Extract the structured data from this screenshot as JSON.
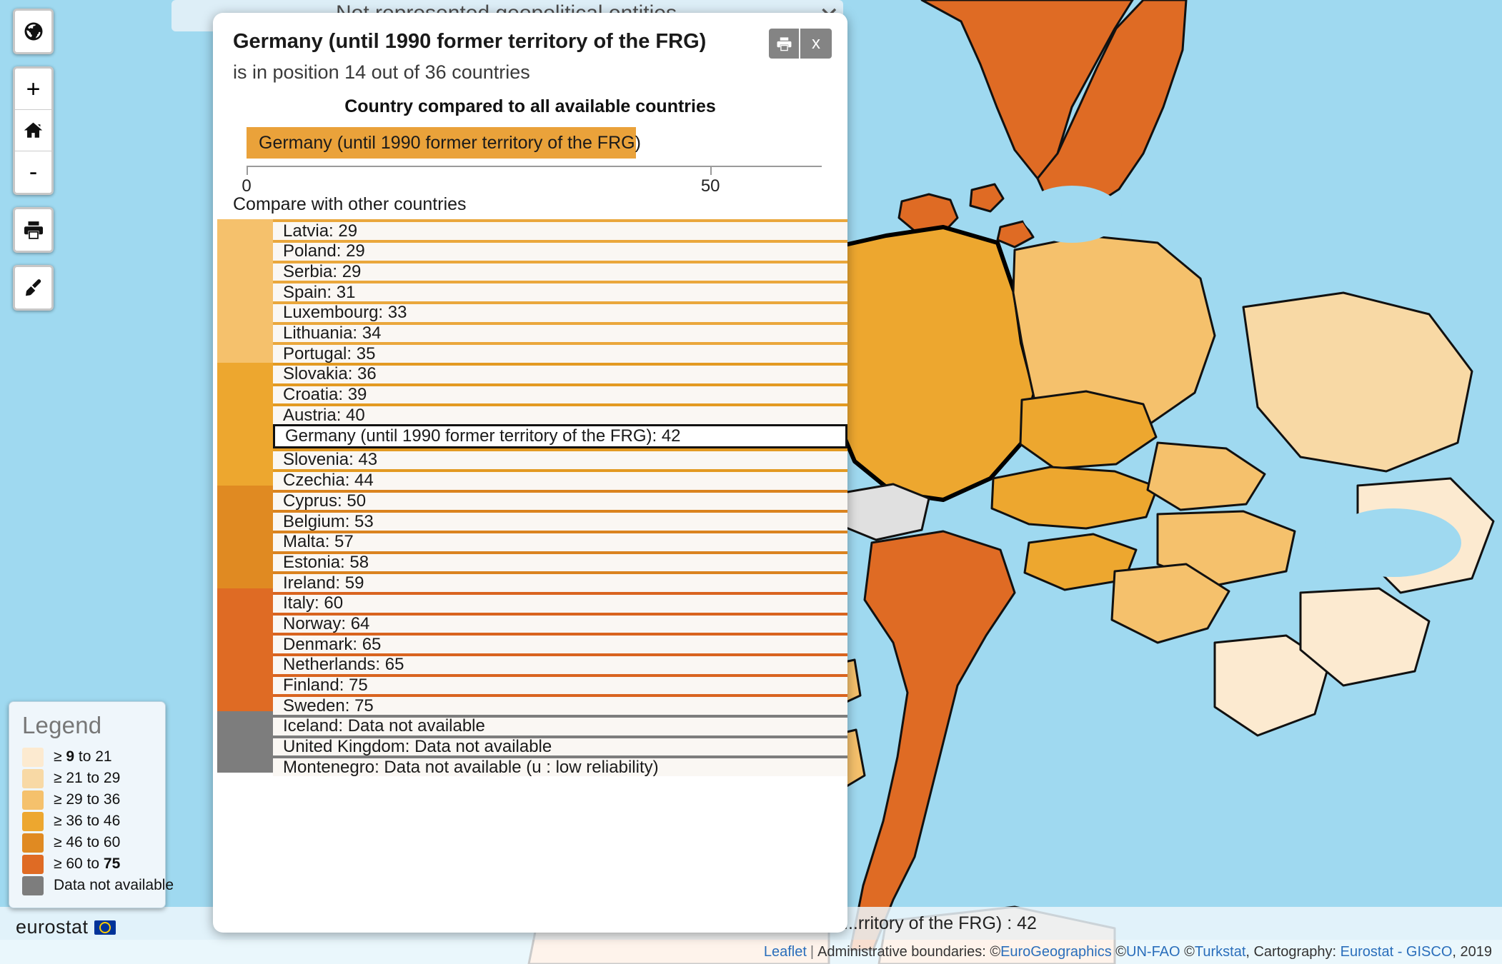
{
  "app": {
    "background_title": "Not represented geopolitical entities",
    "background_close_icon": "close-icon"
  },
  "toolbar": {
    "groups": [
      {
        "buttons": [
          {
            "name": "globe-icon",
            "label": ""
          }
        ]
      },
      {
        "buttons": [
          {
            "name": "zoom-in-icon",
            "label": "+"
          },
          {
            "name": "home-icon",
            "label": ""
          },
          {
            "name": "zoom-out-icon",
            "label": "-"
          }
        ]
      },
      {
        "buttons": [
          {
            "name": "print-icon",
            "label": ""
          }
        ]
      },
      {
        "buttons": [
          {
            "name": "brush-icon",
            "label": ""
          }
        ]
      }
    ]
  },
  "legend": {
    "title": "Legend",
    "items": [
      {
        "color": "#fcead0",
        "prefix": "≥ ",
        "bold_low": "9",
        "mid": " to ",
        "high": "21",
        "bold_high": false
      },
      {
        "color": "#f8d9a5",
        "prefix": "≥ ",
        "bold_low": "21",
        "mid": " to ",
        "high": "29",
        "bold_high": false
      },
      {
        "color": "#f5c16c",
        "prefix": "≥ ",
        "bold_low": "29",
        "mid": " to ",
        "high": "36",
        "bold_high": false
      },
      {
        "color": "#eda72f",
        "prefix": "≥ ",
        "bold_low": "36",
        "mid": " to ",
        "high": "46",
        "bold_high": false
      },
      {
        "color": "#e08a22",
        "prefix": "≥ ",
        "bold_low": "46",
        "mid": " to ",
        "high": "60",
        "bold_high": false
      },
      {
        "color": "#df6b24",
        "prefix": "≥ ",
        "bold_low": "60",
        "mid": " to ",
        "high": "75",
        "bold_high": true
      },
      {
        "color": "#7d7d7d",
        "text": "Data not available"
      }
    ]
  },
  "eurostat": {
    "wordmark": "eurostat"
  },
  "popup": {
    "title": "Germany (until 1990 former territory of the FRG)",
    "subtitle": "is in position 14 out of 36 countries",
    "controls": [
      {
        "name": "popup-print-button",
        "icon": "print-icon",
        "label": ""
      },
      {
        "name": "popup-close-button",
        "icon": "close-icon",
        "label": "x"
      }
    ],
    "compare_label": "Compare with other countries"
  },
  "map_status": "...rritory of the FRG) : 42",
  "attribution": {
    "leaflet": "Leaflet",
    "text_1": "Administrative boundaries: ©",
    "link_1": "EuroGeographics",
    "text_2": " ©",
    "link_2": "UN-FAO",
    "text_3": " ©",
    "link_3": "Turkstat",
    "text_4": ", Cartography: ",
    "link_4": "Eurostat - GISCO",
    "text_5": ", 2019"
  },
  "chart_data": {
    "type": "bar",
    "title": "Country compared to all available countries",
    "orientation": "horizontal",
    "categories": [
      "Germany (until 1990 former territory of the FRG)"
    ],
    "values": [
      42
    ],
    "bar_color": "#eaa23a",
    "xlabel": "",
    "ylabel": "",
    "xlim": [
      0,
      62
    ],
    "xticks": [
      0,
      50
    ],
    "xtick_labels": [
      "0",
      "50"
    ],
    "grid": false,
    "legend": "none"
  },
  "compare_list": {
    "selected_index": 10,
    "rows": [
      {
        "label": "Latvia: 29",
        "country": "Latvia",
        "value": 29,
        "swatch": "#f5c16c",
        "border": "#eaa73c"
      },
      {
        "label": "Poland: 29",
        "country": "Poland",
        "value": 29,
        "swatch": "#f5c16c",
        "border": "#eaa73c"
      },
      {
        "label": "Serbia: 29",
        "country": "Serbia",
        "value": 29,
        "swatch": "#f5c16c",
        "border": "#eaa73c"
      },
      {
        "label": "Spain: 31",
        "country": "Spain",
        "value": 31,
        "swatch": "#f5c16c",
        "border": "#eaa73c"
      },
      {
        "label": "Luxembourg: 33",
        "country": "Luxembourg",
        "value": 33,
        "swatch": "#f5c16c",
        "border": "#eaa73c"
      },
      {
        "label": "Lithuania: 34",
        "country": "Lithuania",
        "value": 34,
        "swatch": "#f5c16c",
        "border": "#eaa73c"
      },
      {
        "label": "Portugal: 35",
        "country": "Portugal",
        "value": 35,
        "swatch": "#f5c16c",
        "border": "#eaa73c"
      },
      {
        "label": "Slovakia: 36",
        "country": "Slovakia",
        "value": 36,
        "swatch": "#eda72f",
        "border": "#e39a22"
      },
      {
        "label": "Croatia: 39",
        "country": "Croatia",
        "value": 39,
        "swatch": "#eda72f",
        "border": "#e39a22"
      },
      {
        "label": "Austria: 40",
        "country": "Austria",
        "value": 40,
        "swatch": "#eda72f",
        "border": "#e39a22"
      },
      {
        "label": "Germany (until 1990 former territory of the FRG): 42",
        "country": "Germany (until 1990 former territory of the FRG)",
        "value": 42,
        "swatch": "#eda72f",
        "border": "#111111"
      },
      {
        "label": "Slovenia: 43",
        "country": "Slovenia",
        "value": 43,
        "swatch": "#eda72f",
        "border": "#e39a22"
      },
      {
        "label": "Czechia: 44",
        "country": "Czechia",
        "value": 44,
        "swatch": "#eda72f",
        "border": "#e39a22"
      },
      {
        "label": "Cyprus: 50",
        "country": "Cyprus",
        "value": 50,
        "swatch": "#e08a22",
        "border": "#da831f"
      },
      {
        "label": "Belgium: 53",
        "country": "Belgium",
        "value": 53,
        "swatch": "#e08a22",
        "border": "#da831f"
      },
      {
        "label": "Malta: 57",
        "country": "Malta",
        "value": 57,
        "swatch": "#e08a22",
        "border": "#da831f"
      },
      {
        "label": "Estonia: 58",
        "country": "Estonia",
        "value": 58,
        "swatch": "#e08a22",
        "border": "#da831f"
      },
      {
        "label": "Ireland: 59",
        "country": "Ireland",
        "value": 59,
        "swatch": "#e08a22",
        "border": "#da831f"
      },
      {
        "label": "Italy: 60",
        "country": "Italy",
        "value": 60,
        "swatch": "#df6b24",
        "border": "#d9641f"
      },
      {
        "label": "Norway: 64",
        "country": "Norway",
        "value": 64,
        "swatch": "#df6b24",
        "border": "#d9641f"
      },
      {
        "label": "Denmark: 65",
        "country": "Denmark",
        "value": 65,
        "swatch": "#df6b24",
        "border": "#d9641f"
      },
      {
        "label": "Netherlands: 65",
        "country": "Netherlands",
        "value": 65,
        "swatch": "#df6b24",
        "border": "#d9641f"
      },
      {
        "label": "Finland: 75",
        "country": "Finland",
        "value": 75,
        "swatch": "#df6b24",
        "border": "#d9641f"
      },
      {
        "label": "Sweden: 75",
        "country": "Sweden",
        "value": 75,
        "swatch": "#df6b24",
        "border": "#d9641f"
      },
      {
        "label": "Iceland: Data not available",
        "country": "Iceland",
        "value": null,
        "swatch": "#7d7d7d",
        "border": "#7d7d7d"
      },
      {
        "label": "United Kingdom: Data not available",
        "country": "United Kingdom",
        "value": null,
        "swatch": "#7d7d7d",
        "border": "#7d7d7d"
      },
      {
        "label": "Montenegro: Data not available (u : low reliability)",
        "country": "Montenegro",
        "value": null,
        "swatch": "#7d7d7d",
        "border": "#7d7d7d"
      }
    ]
  }
}
